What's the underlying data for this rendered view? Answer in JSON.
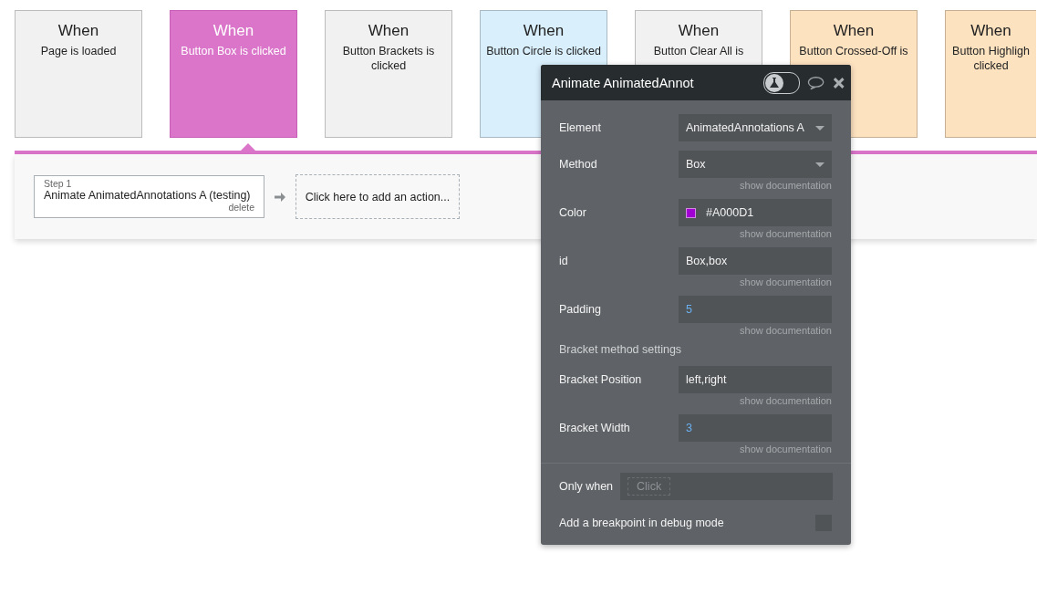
{
  "events": [
    {
      "title": "When",
      "subtitle": "Page is loaded",
      "color": "#f0f1f0",
      "selected": false
    },
    {
      "title": "When",
      "subtitle": "Button Box is clicked",
      "color": "#da75c9",
      "selected": true
    },
    {
      "title": "When",
      "subtitle": "Button Brackets is clicked",
      "color": "#f0f1f0",
      "selected": false
    },
    {
      "title": "When",
      "subtitle": "Button Circle is clicked",
      "color": "#d9effc",
      "selected": false
    },
    {
      "title": "When",
      "subtitle": "Button Clear All is",
      "color": "#f0f1f0",
      "selected": false
    },
    {
      "title": "When",
      "subtitle": "Button Crossed-Off is",
      "color": "#fde2c0",
      "selected": false
    },
    {
      "title": "When",
      "subtitle": "Button Highligh\nclicked",
      "color": "#fde2c0",
      "selected": false
    }
  ],
  "workflow": {
    "steps": [
      {
        "step_label": "Step 1",
        "action": "Animate AnimatedAnnotations A (testing)",
        "delete": "delete"
      }
    ],
    "add_action": "Click here to add an action..."
  },
  "panel": {
    "title": "Animate AnimatedAnnot",
    "debug_toggle": {
      "on": false
    },
    "fields": [
      {
        "kind": "dropdown",
        "label": "Element",
        "value": "AnimatedAnnotations A"
      },
      {
        "kind": "dropdown",
        "label": "Method",
        "value": "Box",
        "doc": "show documentation"
      },
      {
        "kind": "color",
        "label": "Color",
        "value": "#A000D1",
        "color": "#a000d1",
        "doc": "show documentation"
      },
      {
        "kind": "text",
        "label": "id",
        "value": "Box,box",
        "doc": "show documentation"
      },
      {
        "kind": "number",
        "label": "Padding",
        "value": "5",
        "doc": "show documentation"
      },
      {
        "kind": "section",
        "label": "Bracket method settings"
      },
      {
        "kind": "text",
        "label": "Bracket Position",
        "value": "left,right",
        "doc": "show documentation"
      },
      {
        "kind": "number",
        "label": "Bracket Width",
        "value": "3",
        "doc": "show documentation"
      }
    ],
    "only_when": {
      "label": "Only when",
      "placeholder": "Click"
    },
    "breakpoint": {
      "label": "Add a breakpoint in debug mode",
      "checked": false
    }
  }
}
